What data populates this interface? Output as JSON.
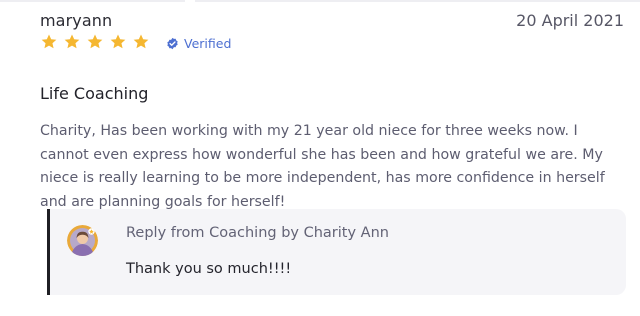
{
  "review": {
    "reviewer_name": "maryann",
    "date": "20 April 2021",
    "rating": 5,
    "rating_max": 5,
    "verified_label": "Verified",
    "service_title": "Life Coaching",
    "text": "Charity, Has been working with my 21 year old niece for three weeks now. I cannot even express how wonderful she has been and how grateful we are. My niece is really learning to be more independent, has more confidence in herself and are planning goals for herself!"
  },
  "reply": {
    "header": "Reply from Coaching by Charity Ann",
    "text": "Thank you so much!!!!"
  },
  "colors": {
    "star": "#f5b731",
    "verified": "#4d6fd1",
    "accent_bar": "#1f1f24"
  },
  "icons": {
    "star": "star-icon",
    "verified": "verified-check-icon",
    "avatar": "avatar"
  }
}
